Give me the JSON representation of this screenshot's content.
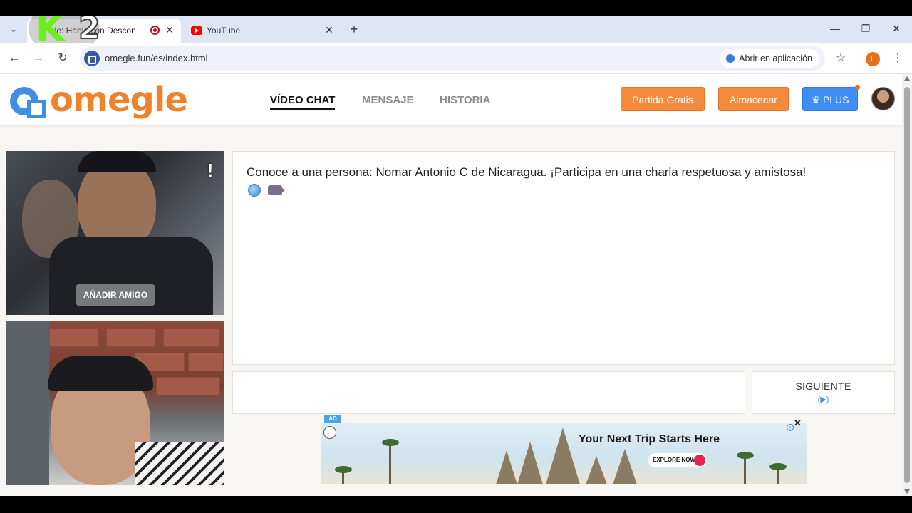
{
  "browser": {
    "tabs": [
      {
        "title": "gle: Habla con Descon",
        "active": true
      },
      {
        "title": "YouTube",
        "active": false
      }
    ],
    "url": "omegle.fun/es/index.html",
    "open_in_app": "Abrir en aplicación",
    "profile_initial": "L",
    "watermark": "K2"
  },
  "site": {
    "logo_text": "omegle",
    "nav": [
      {
        "label": "VÍDEO CHAT",
        "active": true
      },
      {
        "label": "MENSAJE",
        "active": false
      },
      {
        "label": "HISTORIA",
        "active": false
      }
    ],
    "buttons": {
      "free_match": "Partida Gratis",
      "store": "Almacenar",
      "plus": "PLUS"
    },
    "video": {
      "report_icon": "!",
      "add_friend": "AÑADIR AMIGO"
    },
    "chat": {
      "message": "Conoce a una persona: Nomar Antonio C de Nicaragua. ¡Participa en una charla respetuosa y amistosa!",
      "next_label": "SIGUIENTE",
      "next_shortcut": "(▶)"
    },
    "ad": {
      "badge": "AD",
      "title": "Your Next Trip Starts Here",
      "cta": "EXPLORE NOW!",
      "close": "✕",
      "info": "i"
    }
  },
  "colors": {
    "accent_orange": "#f6893c",
    "accent_blue": "#3f8ef5",
    "logo_orange": "#f0822b",
    "logo_blue": "#3f8ee6"
  }
}
